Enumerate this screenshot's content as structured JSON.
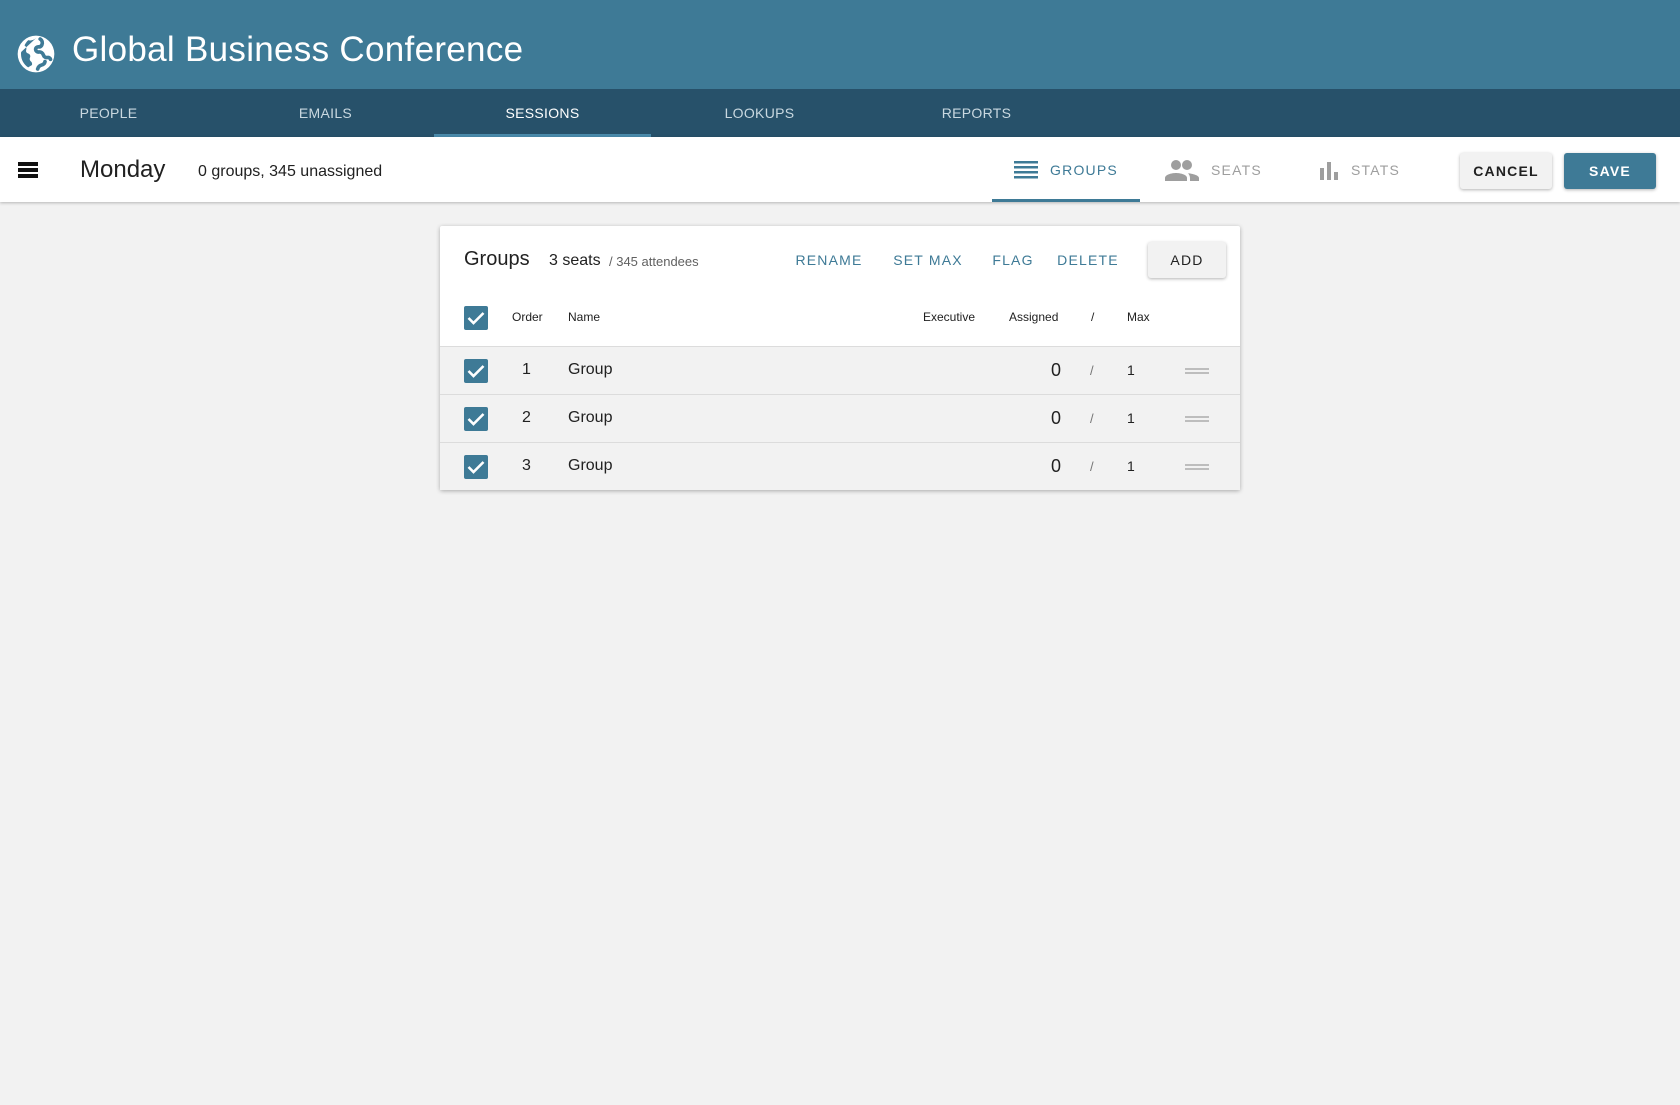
{
  "app": {
    "title": "Global Business Conference",
    "brand_color": "#3e7a96",
    "nav_color": "#27516a"
  },
  "nav": {
    "tabs": [
      {
        "label": "PEOPLE",
        "active": false
      },
      {
        "label": "EMAILS",
        "active": false
      },
      {
        "label": "SESSIONS",
        "active": true
      },
      {
        "label": "LOOKUPS",
        "active": false
      },
      {
        "label": "REPORTS",
        "active": false
      }
    ]
  },
  "toolbar": {
    "menu_icon": "menu-icon",
    "day": "Monday",
    "summary": "0 groups, 345 unassigned",
    "views": [
      {
        "label": "GROUPS",
        "icon": "list-icon",
        "active": true
      },
      {
        "label": "SEATS",
        "icon": "people-icon",
        "active": false
      },
      {
        "label": "STATS",
        "icon": "bar-chart-icon",
        "active": false
      }
    ],
    "cancel_label": "CANCEL",
    "save_label": "SAVE"
  },
  "groups_card": {
    "title": "Groups",
    "seats": "3 seats",
    "attendees": "/ 345 attendees",
    "actions": {
      "rename": "RENAME",
      "set_max": "SET MAX",
      "flag": "FLAG",
      "delete": "DELETE",
      "add": "ADD"
    },
    "columns": {
      "order": "Order",
      "name": "Name",
      "executive": "Executive",
      "assigned": "Assigned",
      "slash": "/",
      "max": "Max"
    },
    "select_all_checked": true,
    "rows": [
      {
        "checked": true,
        "order": "1",
        "name": "Group",
        "assigned": "0",
        "slash": "/",
        "max": "1"
      },
      {
        "checked": true,
        "order": "2",
        "name": "Group",
        "assigned": "0",
        "slash": "/",
        "max": "1"
      },
      {
        "checked": true,
        "order": "3",
        "name": "Group",
        "assigned": "0",
        "slash": "/",
        "max": "1"
      }
    ]
  }
}
